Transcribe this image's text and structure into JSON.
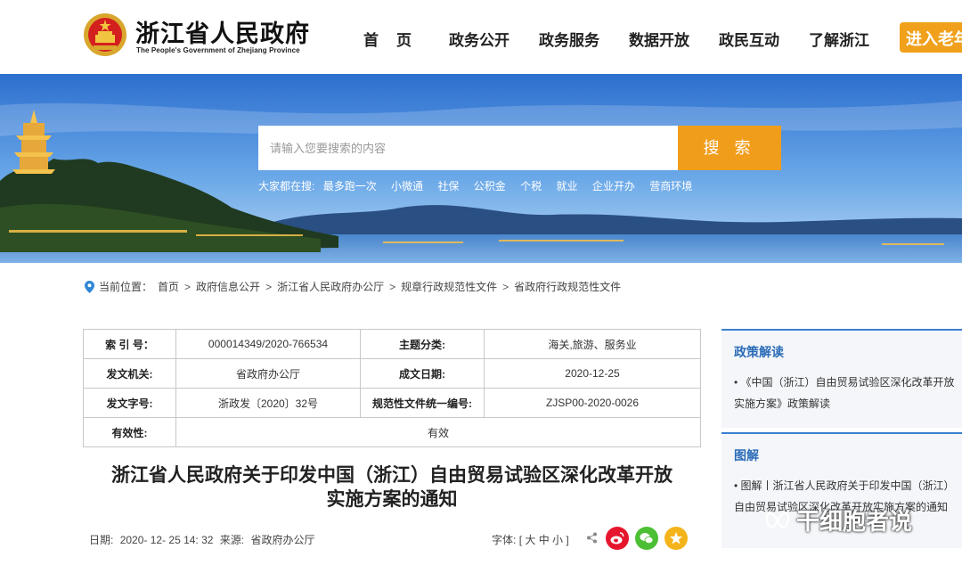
{
  "header": {
    "site_title": "浙江省人民政府",
    "site_subtitle": "The People's Government of Zhejiang Province",
    "nav": [
      "首页",
      "政务公开",
      "政务服务",
      "数据开放",
      "政民互动",
      "了解浙江"
    ],
    "cta": "进入老年"
  },
  "search": {
    "placeholder": "请输入您要搜索的内容",
    "button": "搜 索",
    "hot_label": "大家都在搜:",
    "hot_items": [
      "最多跑一次",
      "小微通",
      "社保",
      "公积金",
      "个税",
      "就业",
      "企业开办",
      "营商环境"
    ]
  },
  "breadcrumb": {
    "label": "当前位置：",
    "items": [
      "首页",
      "政府信息公开",
      "浙江省人民政府办公厅",
      "规章行政规范性文件",
      "省政府行政规范性文件"
    ]
  },
  "meta": {
    "index_no_label": "索 引 号：",
    "index_no": "000014349/2020-766534",
    "topic_label": "主题分类:",
    "topic": "海关,旅游、服务业",
    "issuer_label": "发文机关:",
    "issuer": "省政府办公厅",
    "date_label": "成文日期:",
    "date": "2020-12-25",
    "doc_no_label": "发文字号:",
    "doc_no": "浙政发〔2020〕32号",
    "unified_no_label": "规范性文件统一编号:",
    "unified_no": "ZJSP00-2020-0026",
    "validity_label": "有效性:",
    "validity": "有效"
  },
  "document": {
    "title_line1": "浙江省人民政府关于印发中国（浙江）自由贸易试验区深化改革开放",
    "title_line2": "实施方案的通知",
    "date_label": "日期:",
    "date": "2020- 12- 25 14: 32",
    "source_label": "来源:",
    "source": "省政府办公厅",
    "font_label": "字体:",
    "font_options": "[ 大 中 小 ]"
  },
  "sidebar": {
    "policy_heading": "政策解读",
    "policy_item": "《中国（浙江）自由贸易试验区深化改革开放实施方案》政策解读",
    "graphic_heading": "图解",
    "graphic_item": "图解丨浙江省人民政府关于印发中国（浙江）自由贸易试验区深化改革开放实施方案的通知"
  },
  "watermark": "干细胞者说",
  "colors": {
    "accent_orange": "#f19d1c",
    "sidebar_blue": "#2b6cb8",
    "weibo_red": "#e6162d",
    "wechat_green": "#4cbf34"
  }
}
